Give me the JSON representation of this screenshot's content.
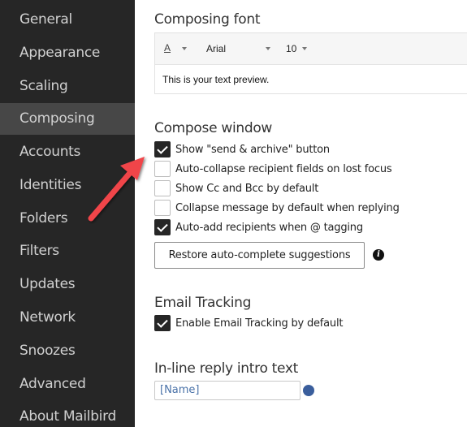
{
  "sidebar": {
    "items": [
      {
        "label": "General"
      },
      {
        "label": "Appearance"
      },
      {
        "label": "Scaling"
      },
      {
        "label": "Composing",
        "active": true
      },
      {
        "label": "Accounts"
      },
      {
        "label": "Identities"
      },
      {
        "label": "Folders"
      },
      {
        "label": "Filters"
      },
      {
        "label": "Updates"
      },
      {
        "label": "Network"
      },
      {
        "label": "Snoozes"
      },
      {
        "label": "Advanced"
      },
      {
        "label": "About Mailbird"
      }
    ]
  },
  "composing_font": {
    "title": "Composing font",
    "color_button_glyph": "A",
    "font_family": "Arial",
    "font_size": "10",
    "preview_text": "This is your text preview."
  },
  "compose_window": {
    "title": "Compose window",
    "options": [
      {
        "label": "Show \"send & archive\" button",
        "checked": true
      },
      {
        "label": "Auto-collapse recipient fields on lost focus",
        "checked": false
      },
      {
        "label": "Show Cc and Bcc by default",
        "checked": false
      },
      {
        "label": "Collapse message by default when replying",
        "checked": false
      },
      {
        "label": "Auto-add recipients when @ tagging",
        "checked": true
      }
    ],
    "restore_button_label": "Restore auto-complete suggestions",
    "info_icon_glyph": "i"
  },
  "email_tracking": {
    "title": "Email Tracking",
    "option": {
      "label": "Enable Email Tracking by default",
      "checked": true
    }
  },
  "inline_reply": {
    "title": "In-line reply intro text",
    "value": "[Name]"
  },
  "annotation": {
    "arrow_color": "#f0444a",
    "points_to": "Show \"send & archive\" button"
  },
  "colors": {
    "sidebar_bg": "#262626",
    "sidebar_active_bg": "#474747",
    "accent_dot": "#3a5e9c"
  }
}
